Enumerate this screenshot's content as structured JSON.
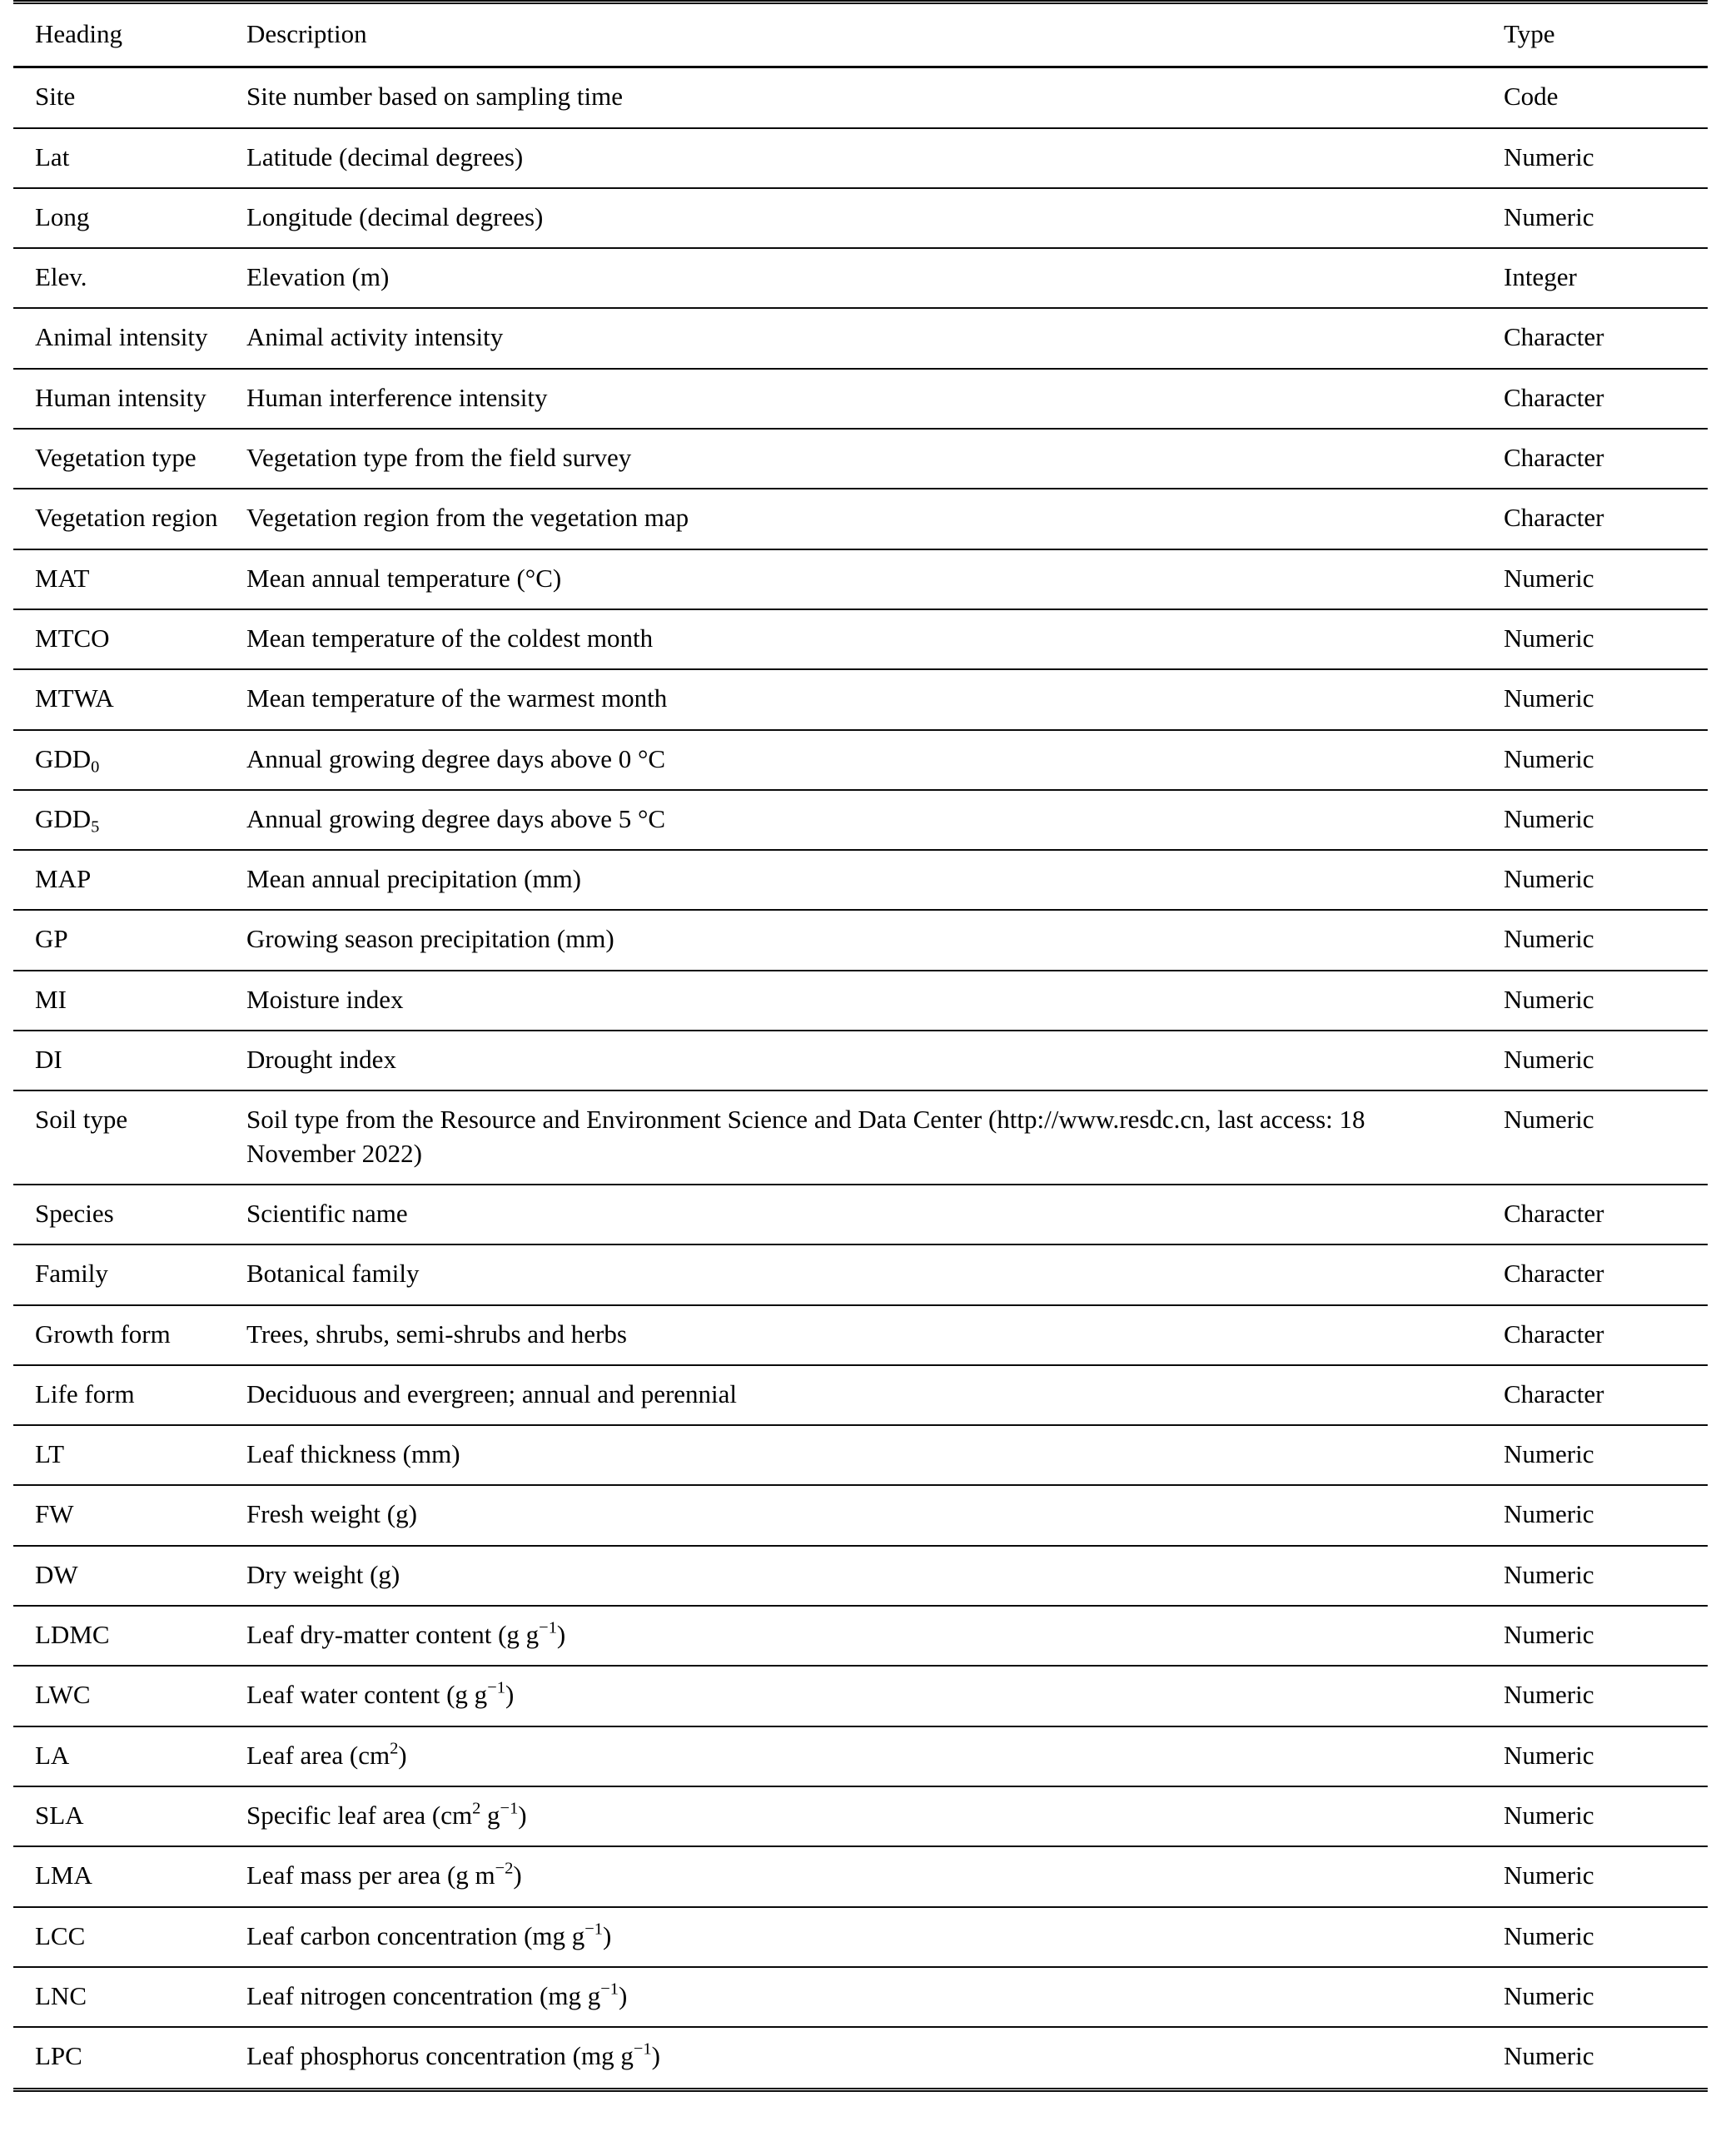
{
  "table": {
    "columns": [
      "Heading",
      "Description",
      "Type"
    ],
    "rows": [
      {
        "heading": "Site",
        "description": "Site number based on sampling time",
        "type": "Code"
      },
      {
        "heading": "Lat",
        "description": "Latitude (decimal degrees)",
        "type": "Numeric"
      },
      {
        "heading": "Long",
        "description": "Longitude (decimal degrees)",
        "type": "Numeric"
      },
      {
        "heading": "Elev.",
        "description": "Elevation (m)",
        "type": "Integer"
      },
      {
        "heading": "Animal intensity",
        "description": "Animal activity intensity",
        "type": "Character"
      },
      {
        "heading": "Human intensity",
        "description": "Human interference intensity",
        "type": "Character"
      },
      {
        "heading": "Vegetation type",
        "description": "Vegetation type from the field survey",
        "type": "Character"
      },
      {
        "heading": "Vegetation region",
        "description": "Vegetation region from the vegetation map",
        "type": "Character"
      },
      {
        "heading": "MAT",
        "description": "Mean annual temperature (°C)",
        "type": "Numeric"
      },
      {
        "heading": "MTCO",
        "description": "Mean temperature of the coldest month",
        "type": "Numeric"
      },
      {
        "heading": "MTWA",
        "description": "Mean temperature of the warmest month",
        "type": "Numeric"
      },
      {
        "heading": "GDD0",
        "heading_base": "GDD",
        "heading_sub": "0",
        "description": "Annual growing degree days above 0 °C",
        "type": "Numeric"
      },
      {
        "heading": "GDD5",
        "heading_base": "GDD",
        "heading_sub": "5",
        "description": "Annual growing degree days above 5 °C",
        "type": "Numeric"
      },
      {
        "heading": "MAP",
        "description": "Mean annual precipitation (mm)",
        "type": "Numeric"
      },
      {
        "heading": "GP",
        "description": "Growing season precipitation (mm)",
        "type": "Numeric"
      },
      {
        "heading": "MI",
        "description": "Moisture index",
        "type": "Numeric"
      },
      {
        "heading": "DI",
        "description": "Drought index",
        "type": "Numeric"
      },
      {
        "heading": "Soil type",
        "description": "Soil type from the Resource and Environment Science and Data Center (http://www.resdc.cn, last access: 18 November 2022)",
        "type": "Numeric"
      },
      {
        "heading": "Species",
        "description": "Scientific name",
        "type": "Character"
      },
      {
        "heading": "Family",
        "description": "Botanical family",
        "type": "Character"
      },
      {
        "heading": "Growth form",
        "description": "Trees, shrubs, semi-shrubs and herbs",
        "type": "Character"
      },
      {
        "heading": "Life form",
        "description": "Deciduous and evergreen; annual and perennial",
        "type": "Character"
      },
      {
        "heading": "LT",
        "description": "Leaf thickness (mm)",
        "type": "Numeric"
      },
      {
        "heading": "FW",
        "description": "Fresh weight (g)",
        "type": "Numeric"
      },
      {
        "heading": "DW",
        "description": "Dry weight (g)",
        "type": "Numeric"
      },
      {
        "heading": "LDMC",
        "description": "Leaf dry-matter content (g g−1)",
        "desc_pre": "Leaf dry-matter content (g g",
        "desc_sup": "−1",
        "desc_post": ")",
        "type": "Numeric"
      },
      {
        "heading": "LWC",
        "description": "Leaf water content (g g−1)",
        "desc_pre": "Leaf water content (g g",
        "desc_sup": "−1",
        "desc_post": ")",
        "type": "Numeric"
      },
      {
        "heading": "LA",
        "description": "Leaf area (cm2)",
        "desc_pre": "Leaf area (cm",
        "desc_sup": "2",
        "desc_post": ")",
        "type": "Numeric"
      },
      {
        "heading": "SLA",
        "description": "Specific leaf area (cm2 g−1)",
        "desc_pre": "Specific leaf area (cm",
        "desc_sup": "2",
        "desc_mid": " g",
        "desc_sup2": "−1",
        "desc_post": ")",
        "type": "Numeric"
      },
      {
        "heading": "LMA",
        "description": "Leaf mass per area (g m−2)",
        "desc_pre": "Leaf mass per area (g m",
        "desc_sup": "−2",
        "desc_post": ")",
        "type": "Numeric"
      },
      {
        "heading": "LCC",
        "description": "Leaf carbon concentration (mg g−1)",
        "desc_pre": "Leaf carbon concentration (mg g",
        "desc_sup": "−1",
        "desc_post": ")",
        "type": "Numeric"
      },
      {
        "heading": "LNC",
        "description": "Leaf nitrogen concentration (mg g−1)",
        "desc_pre": "Leaf nitrogen concentration (mg g",
        "desc_sup": "−1",
        "desc_post": ")",
        "type": "Numeric"
      },
      {
        "heading": "LPC",
        "description": "Leaf phosphorus concentration (mg g−1)",
        "desc_pre": "Leaf phosphorus concentration (mg g",
        "desc_sup": "−1",
        "desc_post": ")",
        "type": "Numeric"
      }
    ]
  }
}
